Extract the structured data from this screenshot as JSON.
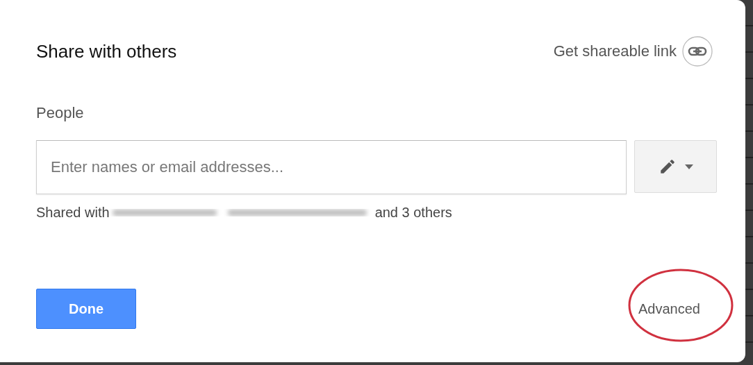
{
  "dialog": {
    "title": "Share with others",
    "shareable_link": "Get shareable link",
    "people_label": "People",
    "people_field": {
      "placeholder": "Enter names or email addresses..."
    },
    "shared_with": {
      "prefix": "Shared with",
      "suffix": "and 3 others"
    },
    "done_button": "Done",
    "advanced_link": "Advanced"
  }
}
